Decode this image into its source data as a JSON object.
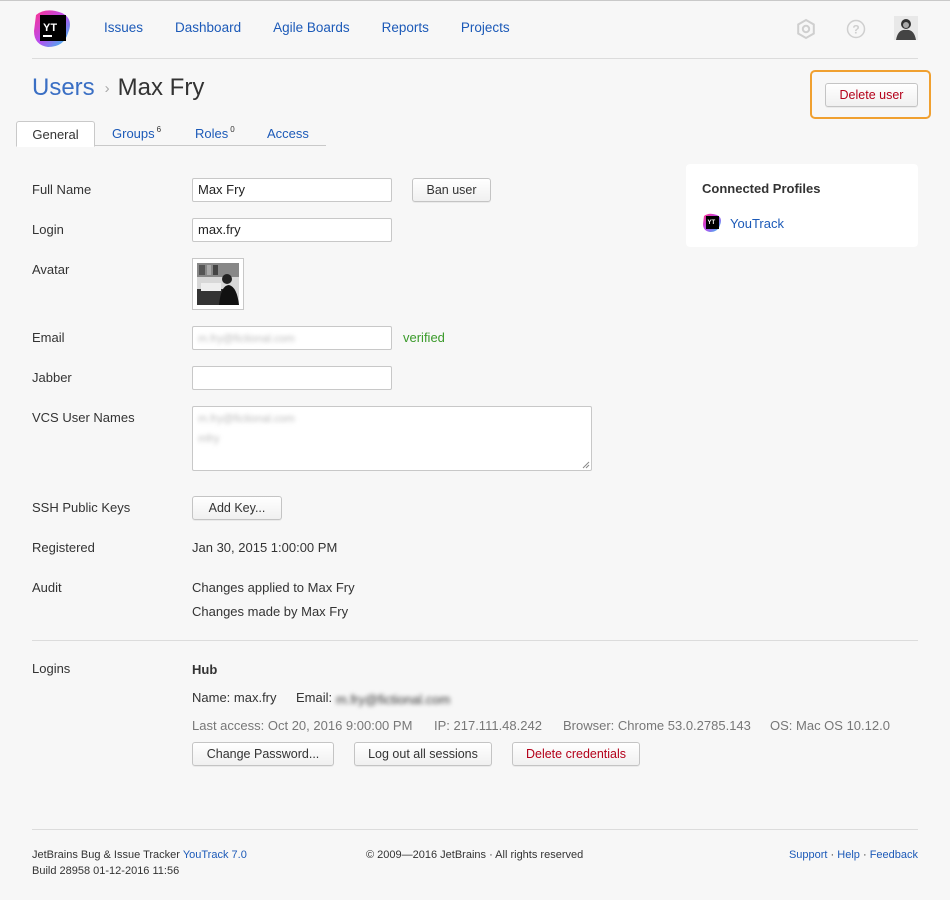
{
  "nav": {
    "items": [
      "Issues",
      "Dashboard",
      "Agile Boards",
      "Reports",
      "Projects"
    ],
    "logo_text": "YT"
  },
  "header": {
    "icons": [
      "settings-icon",
      "help-icon",
      "user-avatar"
    ]
  },
  "title": {
    "crumb": "Users",
    "separator": "›",
    "current": "Max Fry"
  },
  "actions": {
    "delete_user": "Delete user"
  },
  "tabs": [
    {
      "label": "General",
      "count": ""
    },
    {
      "label": "Groups",
      "count": "6"
    },
    {
      "label": "Roles",
      "count": "0"
    },
    {
      "label": "Access",
      "count": ""
    }
  ],
  "form": {
    "full_name_label": "Full Name",
    "full_name_value": "Max Fry",
    "ban_user": "Ban user",
    "login_label": "Login",
    "login_value": "max.fry",
    "avatar_label": "Avatar",
    "email_label": "Email",
    "email_value": "m.fry@fictional.com",
    "email_status": "verified",
    "jabber_label": "Jabber",
    "jabber_value": "",
    "vcs_label": "VCS User Names",
    "vcs_line1": "m.fry@fictional.com",
    "vcs_line2": "mfry",
    "ssh_label": "SSH Public Keys",
    "add_key": "Add Key...",
    "registered_label": "Registered",
    "registered_value": "Jan 30, 2015 1:00:00 PM",
    "audit_label": "Audit",
    "audit_link1": "Changes applied to Max Fry",
    "audit_link2": "Changes made by Max Fry"
  },
  "logins": {
    "label": "Logins",
    "hub_title": "Hub",
    "name": "Name: max.fry",
    "email_prefix": "Email:",
    "email_value": "m.fry@fictional.com",
    "last_access": "Last access: Oct 20, 2016 9:00:00 PM",
    "ip": "IP: 217.111.48.242",
    "browser": "Browser: Chrome 53.0.2785.143",
    "os": "OS: Mac OS 10.12.0",
    "change_password": "Change Password...",
    "logout_all": "Log out all sessions",
    "delete_credentials": "Delete credentials"
  },
  "connected": {
    "title": "Connected Profiles",
    "profile": "YouTrack"
  },
  "footer": {
    "product_prefix": "JetBrains Bug & Issue Tracker",
    "product_link": "YouTrack 7.0",
    "build": "Build 28958 01-12-2016 11:56",
    "copyright": "© 2009—2016 JetBrains · All rights reserved",
    "support": "Support",
    "help": "Help",
    "feedback": "Feedback",
    "dot": "·"
  },
  "colors": {
    "link": "#1c5ab8",
    "danger": "#b4001a",
    "verified": "#3a9a2a",
    "highlight": "#f0a030"
  }
}
